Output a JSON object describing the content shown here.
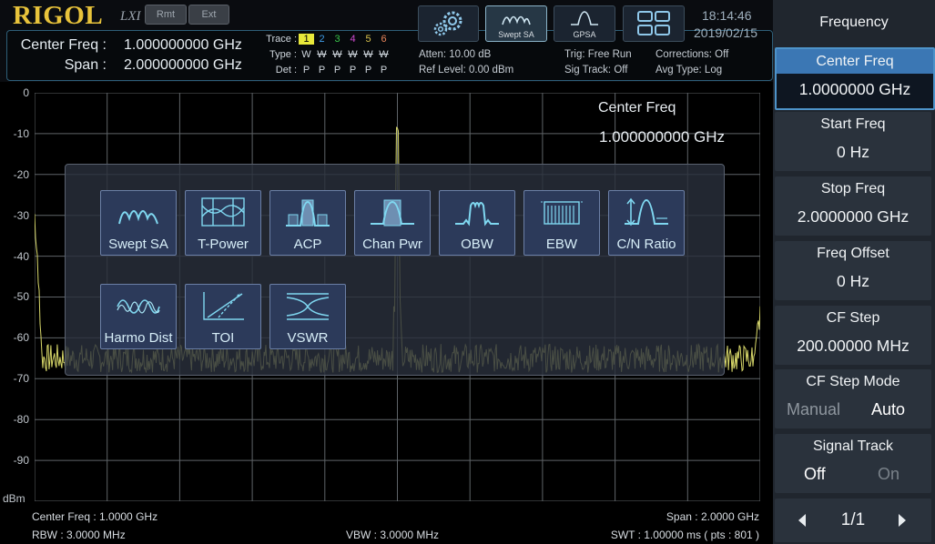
{
  "header": {
    "logo": "RIGOL",
    "lxi": "LXI",
    "rmt": "Rmt",
    "ext": "Ext",
    "center_freq_label": "Center Freq :",
    "center_freq_value": "1.000000000 GHz",
    "span_label": "Span :",
    "span_value": "2.000000000 GHz",
    "trace": {
      "trace_label": "Trace :",
      "type_label": "Type :",
      "det_label": "Det :",
      "numbers": [
        "1",
        "2",
        "3",
        "4",
        "5",
        "6"
      ],
      "number_colors": [
        "#000000",
        "#3f9be6",
        "#39c449",
        "#d24bd2",
        "#d9c24c",
        "#e8845a"
      ],
      "types": [
        "W",
        "W",
        "W",
        "W",
        "W",
        "W"
      ],
      "dets": [
        "P",
        "P",
        "P",
        "P",
        "P",
        "P"
      ]
    },
    "atten": "Atten: 10.00 dB",
    "ref_level": "Ref Level: 0.00 dBm",
    "trig": "Trig: Free Run",
    "sig_track": "Sig Track: Off",
    "corrections": "Corrections: Off",
    "avg_type": "Avg Type: Log",
    "modes": [
      {
        "name": "settings",
        "label": ""
      },
      {
        "name": "swept-sa",
        "label": "Swept SA"
      },
      {
        "name": "gpsa",
        "label": "GPSA"
      },
      {
        "name": "layout",
        "label": ""
      }
    ],
    "time": "18:14:46",
    "date": "2019/02/15"
  },
  "plot": {
    "y_ticks": [
      "0",
      "-10",
      "-20",
      "-30",
      "-40",
      "-50",
      "-60",
      "-70",
      "-80",
      "-90"
    ],
    "y_unit": "dBm",
    "marker_label": "Center Freq",
    "marker_value": "1.000000000 GHz",
    "trace_color": "#d8d86a"
  },
  "measure_menu": {
    "row1": [
      "Swept SA",
      "T-Power",
      "ACP",
      "Chan Pwr",
      "OBW",
      "EBW",
      "C/N Ratio"
    ],
    "row2": [
      "Harmo Dist",
      "TOI",
      "VSWR"
    ]
  },
  "bottom": {
    "center_freq": "Center Freq : 1.0000 GHz",
    "rbw": "RBW : 3.0000 MHz",
    "vbw": "VBW : 3.0000 MHz",
    "span": "Span : 2.0000 GHz",
    "swt": "SWT : 1.00000 ms ( pts : 801 )"
  },
  "panel": {
    "title": "Frequency",
    "keys": [
      {
        "title": "Center Freq",
        "value": "1.0000000 GHz"
      },
      {
        "title": "Start Freq",
        "value": "0 Hz"
      },
      {
        "title": "Stop Freq",
        "value": "2.0000000 GHz"
      },
      {
        "title": "Freq Offset",
        "value": "0 Hz"
      },
      {
        "title": "CF Step",
        "value": "200.00000 MHz"
      }
    ],
    "cf_step_mode": {
      "title": "CF Step Mode",
      "opt_a": "Manual",
      "opt_b": "Auto"
    },
    "signal_track": {
      "title": "Signal Track",
      "opt_a": "Off",
      "opt_b": "On"
    },
    "page": "1/1"
  },
  "colors": {
    "accent": "#3b77b4",
    "logo": "#e8c33b",
    "grid": "#5f6468"
  }
}
